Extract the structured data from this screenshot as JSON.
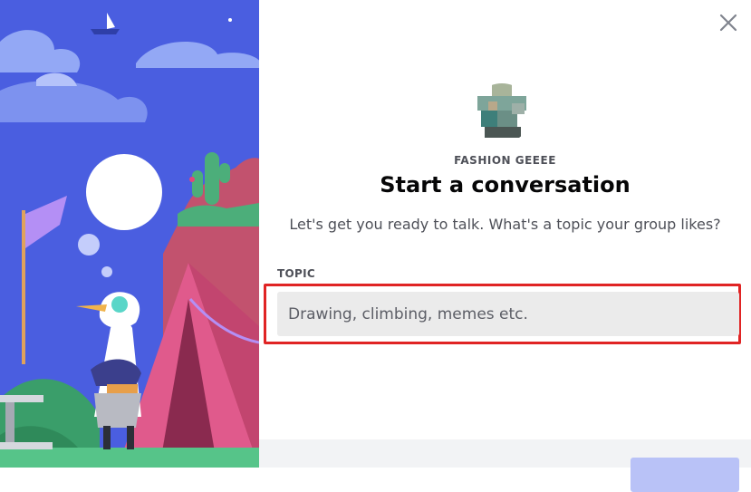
{
  "dialog": {
    "server_name": "FASHION GEEEE",
    "title": "Start a conversation",
    "subtitle": "Let's get you ready to talk. What's a topic your group likes?",
    "topic_label": "TOPIC",
    "topic_placeholder": "Drawing, climbing, memes etc.",
    "topic_value": ""
  },
  "icons": {
    "close": "close-icon",
    "avatar": "server-avatar"
  },
  "colors": {
    "sky": "#4a5ee0",
    "highlight": "#e02424",
    "button": "#b9c2f7"
  }
}
